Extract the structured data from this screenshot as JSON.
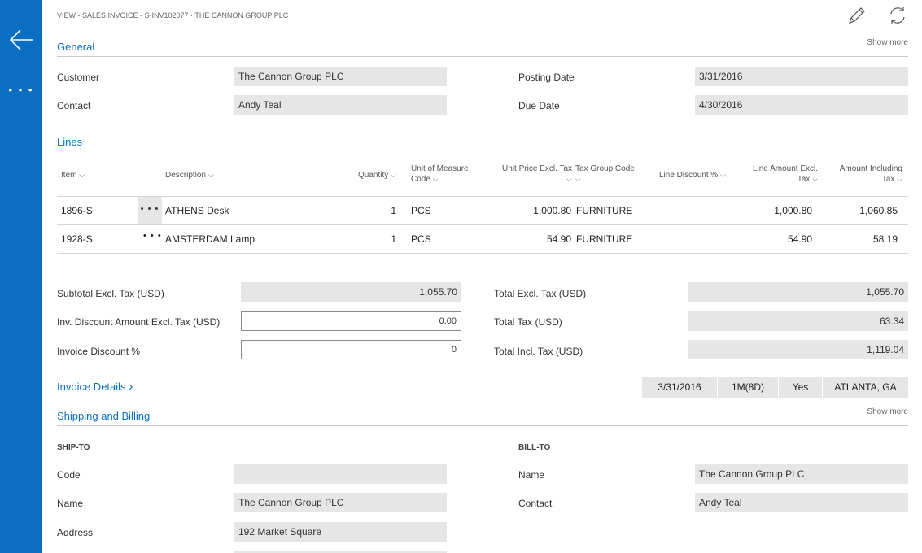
{
  "nav": {
    "more_label": "• • •"
  },
  "header": {
    "breadcrumb": "VIEW - SALES INVOICE - S-INV102077 · THE CANNON GROUP PLC"
  },
  "general": {
    "title": "General",
    "show_more": "Show more",
    "customer_label": "Customer",
    "customer_value": "The Cannon Group PLC",
    "contact_label": "Contact",
    "contact_value": "Andy Teal",
    "posting_date_label": "Posting Date",
    "posting_date_value": "3/31/2016",
    "due_date_label": "Due Date",
    "due_date_value": "4/30/2016"
  },
  "lines": {
    "title": "Lines",
    "columns": {
      "item": "Item",
      "description": "Description",
      "quantity": "Quantity",
      "uom_1": "Unit of Measure",
      "uom_2": "Code",
      "unit_price_1": "Unit Price Excl. Tax",
      "tax_group": "Tax Group Code",
      "line_discount": "Line Discount %",
      "line_amount_1": "Line Amount Excl.",
      "line_amount_2": "Tax",
      "amount_incl_1": "Amount Including",
      "amount_incl_2": "Tax"
    },
    "rows": [
      {
        "item": "1896-S",
        "description": "ATHENS Desk",
        "quantity": "1",
        "uom": "PCS",
        "unit_price": "1,000.80",
        "tax_group": "FURNITURE",
        "line_amount": "1,000.80",
        "amount_incl": "1,060.85"
      },
      {
        "item": "1928-S",
        "description": "AMSTERDAM Lamp",
        "quantity": "1",
        "uom": "PCS",
        "unit_price": "54.90",
        "tax_group": "FURNITURE",
        "line_amount": "54.90",
        "amount_incl": "58.19"
      }
    ],
    "row_menu": "• • •"
  },
  "totals": {
    "subtotal_label": "Subtotal Excl. Tax (USD)",
    "subtotal_value": "1,055.70",
    "inv_discount_amount_label": "Inv. Discount Amount Excl. Tax (USD)",
    "inv_discount_amount_value": "0.00",
    "invoice_discount_pct_label": "Invoice Discount %",
    "invoice_discount_pct_value": "0",
    "total_excl_label": "Total Excl. Tax (USD)",
    "total_excl_value": "1,055.70",
    "total_tax_label": "Total Tax (USD)",
    "total_tax_value": "63.34",
    "total_incl_label": "Total Incl. Tax (USD)",
    "total_incl_value": "1,119.04"
  },
  "invoice_details": {
    "title": "Invoice Details",
    "chevron": "›",
    "chips": [
      "3/31/2016",
      "1M(8D)",
      "Yes",
      "ATLANTA, GA"
    ]
  },
  "shipping": {
    "title": "Shipping and Billing",
    "show_more": "Show more",
    "ship_to_heading": "SHIP-TO",
    "bill_to_heading": "BILL-TO",
    "code_label": "Code",
    "code_value": "",
    "name_label": "Name",
    "name_value": "The Cannon Group PLC",
    "address_label": "Address",
    "address_value": "192 Market Square",
    "bill_name_label": "Name",
    "bill_name_value": "The Cannon Group PLC",
    "bill_contact_label": "Contact",
    "bill_contact_value": "Andy Teal"
  },
  "colors": {
    "accent": "#0a6fc2",
    "field_bg": "#e6e6e6"
  },
  "icons": {
    "back": "back-arrow-icon",
    "edit": "pencil-icon",
    "refresh": "refresh-icon"
  }
}
